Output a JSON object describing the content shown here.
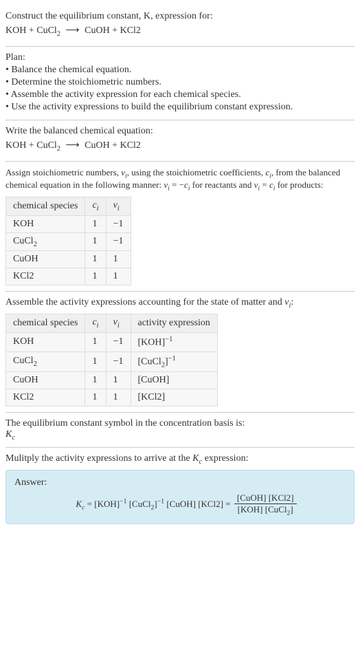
{
  "intro": {
    "line1": "Construct the equilibrium constant, K, expression for:",
    "equation_lhs1": "KOH + CuCl",
    "equation_lhs_sub": "2",
    "arrow": "⟶",
    "equation_rhs": "CuOH + KCl2"
  },
  "plan": {
    "header": "Plan:",
    "items": [
      "• Balance the chemical equation.",
      "• Determine the stoichiometric numbers.",
      "• Assemble the activity expression for each chemical species.",
      "• Use the activity expressions to build the equilibrium constant expression."
    ]
  },
  "balanced": {
    "header": "Write the balanced chemical equation:",
    "lhs1": "KOH + CuCl",
    "lhs_sub": "2",
    "arrow": "⟶",
    "rhs": "CuOH + KCl2"
  },
  "stoich": {
    "intro1": "Assign stoichiometric numbers, ",
    "vi": "ν",
    "vi_sub": "i",
    "intro2": ", using the stoichiometric coefficients, ",
    "ci": "c",
    "ci_sub": "i",
    "intro3": ", from the balanced chemical equation in the following manner: ",
    "eq1a": "ν",
    "eq1b": " = −",
    "eq1c": "c",
    "intro4": " for reactants and ",
    "eq2a": "ν",
    "eq2b": " = ",
    "eq2c": "c",
    "intro5": " for products:",
    "headers": {
      "species": "chemical species",
      "c": "c",
      "c_sub": "i",
      "v": "ν",
      "v_sub": "i"
    },
    "rows": [
      {
        "species": "KOH",
        "sub": "",
        "c": "1",
        "v": "−1"
      },
      {
        "species": "CuCl",
        "sub": "2",
        "c": "1",
        "v": "−1"
      },
      {
        "species": "CuOH",
        "sub": "",
        "c": "1",
        "v": "1"
      },
      {
        "species": "KCl2",
        "sub": "",
        "c": "1",
        "v": "1"
      }
    ]
  },
  "activity": {
    "intro1": "Assemble the activity expressions accounting for the state of matter and ",
    "vi": "ν",
    "vi_sub": "i",
    "intro2": ":",
    "headers": {
      "species": "chemical species",
      "c": "c",
      "c_sub": "i",
      "v": "ν",
      "v_sub": "i",
      "act": "activity expression"
    },
    "rows": [
      {
        "species": "KOH",
        "sub": "",
        "c": "1",
        "v": "−1",
        "act_open": "[KOH]",
        "act_sup": "−1"
      },
      {
        "species": "CuCl",
        "sub": "2",
        "c": "1",
        "v": "−1",
        "act_open": "[CuCl",
        "act_innersub": "2",
        "act_close": "]",
        "act_sup": "−1"
      },
      {
        "species": "CuOH",
        "sub": "",
        "c": "1",
        "v": "1",
        "act_open": "[CuOH]",
        "act_sup": ""
      },
      {
        "species": "KCl2",
        "sub": "",
        "c": "1",
        "v": "1",
        "act_open": "[KCl2]",
        "act_sup": ""
      }
    ]
  },
  "symbol": {
    "line": "The equilibrium constant symbol in the concentration basis is:",
    "k": "K",
    "k_sub": "c"
  },
  "multiply": {
    "line1": "Mulitply the activity expressions to arrive at the ",
    "k": "K",
    "k_sub": "c",
    "line2": " expression:"
  },
  "answer": {
    "label": "Answer:",
    "k": "K",
    "k_sub": "c",
    "eq": " = [KOH]",
    "sup1": "−1",
    "mid1": " [CuCl",
    "midsub": "2",
    "mid1b": "]",
    "sup2": "−1",
    "mid2": " [CuOH] [KCl2] = ",
    "num": "[CuOH] [KCl2]",
    "den1": "[KOH] [CuCl",
    "den_sub": "2",
    "den2": "]"
  }
}
